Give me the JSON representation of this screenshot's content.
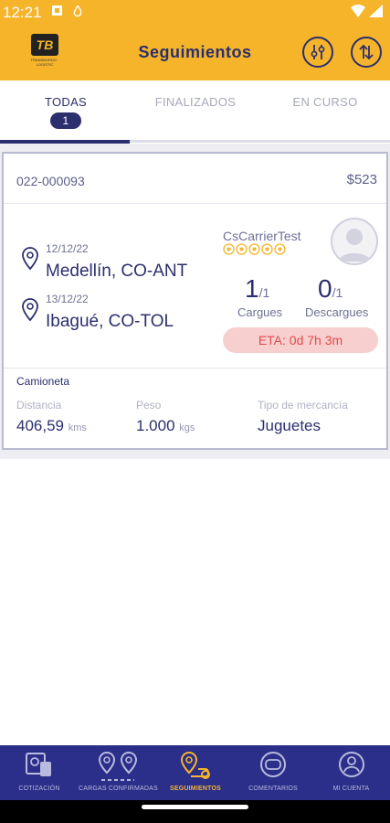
{
  "status_bar": {
    "time": "12:21"
  },
  "header": {
    "title": "Seguimientos",
    "logo_text": "TB",
    "logo_sub": "TRANSBORDO · LOGISTIC"
  },
  "tabs": [
    {
      "label": "TODAS",
      "badge": "1",
      "active": true
    },
    {
      "label": "FINALIZADOS",
      "active": false
    },
    {
      "label": "EN CURSO",
      "active": false
    }
  ],
  "card": {
    "code": "022-000093",
    "price": "$523",
    "origin": {
      "date": "12/12/22",
      "city": "Medellín, CO-ANT"
    },
    "destination": {
      "date": "13/12/22",
      "city": "Ibagué, CO-TOL"
    },
    "carrier": "CsCarrierTest",
    "rating_stars": 5,
    "cargues": {
      "done": "1",
      "total": "/1",
      "label": "Cargues"
    },
    "descargues": {
      "done": "0",
      "total": "/1",
      "label": "Descargues"
    },
    "eta": "ETA:  0d 7h 3m",
    "vehicle": "Camioneta",
    "distance": {
      "label": "Distancia",
      "value": "406,59",
      "unit": "kms"
    },
    "weight": {
      "label": "Peso",
      "value": "1.000",
      "unit": "kgs"
    },
    "cargo": {
      "label": "Tipo de mercancía",
      "value": "Juguetes"
    }
  },
  "bottom_nav": [
    {
      "label": "COTIZACIÓN",
      "icon": "quote-icon",
      "active": false
    },
    {
      "label": "CARGAS CONFIRMADAS",
      "icon": "route-pins-icon",
      "active": false
    },
    {
      "label": "SEGUIMIENTOS",
      "icon": "tracking-icon",
      "active": true
    },
    {
      "label": "COMENTARIOS",
      "icon": "comments-icon",
      "active": false
    },
    {
      "label": "MI CUENTA",
      "icon": "account-icon",
      "active": false
    }
  ],
  "colors": {
    "brand_yellow": "#f5b42a",
    "navy": "#2c2f6e",
    "nav_bg": "#2c2f8a",
    "eta_bg": "#f8cfcf",
    "eta_text": "#e24a4a"
  }
}
